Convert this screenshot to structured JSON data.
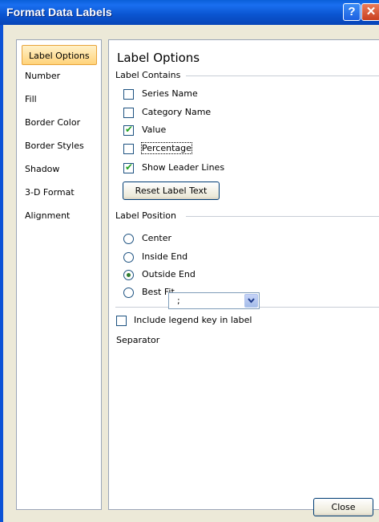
{
  "window": {
    "title": "Format Data Labels",
    "help_glyph": "?",
    "close_glyph": "✕"
  },
  "nav": {
    "items": [
      {
        "label": "Label Options",
        "active": true
      },
      {
        "label": "Number",
        "active": false
      },
      {
        "label": "Fill",
        "active": false
      },
      {
        "label": "Border Color",
        "active": false
      },
      {
        "label": "Border Styles",
        "active": false
      },
      {
        "label": "Shadow",
        "active": false
      },
      {
        "label": "3-D Format",
        "active": false
      },
      {
        "label": "Alignment",
        "active": false
      }
    ]
  },
  "panel": {
    "heading": "Label Options",
    "label_contains": {
      "title": "Label Contains",
      "options": [
        {
          "label": "Series Name",
          "checked": false
        },
        {
          "label": "Category Name",
          "checked": false
        },
        {
          "label": "Value",
          "checked": true
        },
        {
          "label": "Percentage",
          "checked": false
        },
        {
          "label": "Show Leader Lines",
          "checked": true
        }
      ],
      "reset_button": "Reset Label Text"
    },
    "label_position": {
      "title": "Label Position",
      "options": [
        {
          "label": "Center",
          "selected": false
        },
        {
          "label": "Inside End",
          "selected": false
        },
        {
          "label": "Outside End",
          "selected": true
        },
        {
          "label": "Best Fit",
          "selected": false
        }
      ]
    },
    "legend_key": {
      "label": "Include legend key in label",
      "checked": false
    },
    "separator": {
      "label": "Separator",
      "value": ";"
    }
  },
  "footer": {
    "close_button": "Close"
  },
  "colors": {
    "titlebar": "#0a54d0",
    "active_nav": "#ffd37a",
    "window_bg": "#ece9d8"
  }
}
